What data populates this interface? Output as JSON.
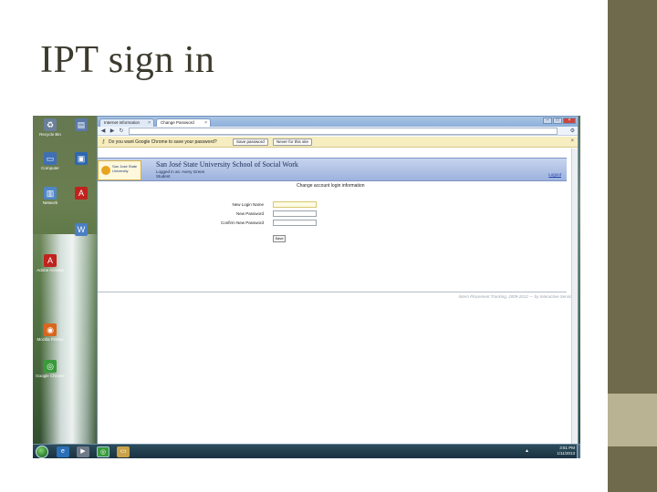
{
  "slide": {
    "title": "IPT sign in",
    "colors": {
      "sidebar": "#6e6a4b",
      "sidebar_accent": "#b9b393",
      "title_text": "#3d3b2e"
    }
  },
  "desktop": {
    "icons": [
      {
        "name": "recycle-bin-icon",
        "label": "Recycle Bin",
        "glyph": "♻"
      },
      {
        "name": "computer-icon",
        "label": "Computer",
        "glyph": "▭"
      },
      {
        "name": "network-icon",
        "label": "Network",
        "glyph": "▥"
      },
      {
        "name": "acrobat-icon",
        "label": "Adobe Acrobat",
        "glyph": "A"
      },
      {
        "name": "firefox-icon",
        "label": "Mozilla Firefox",
        "glyph": "◉"
      },
      {
        "name": "chrome-icon",
        "label": "Google Chrome",
        "glyph": "◎"
      }
    ]
  },
  "browser": {
    "tabs": [
      {
        "label": "Internet Information",
        "active": false
      },
      {
        "label": "Change Password",
        "active": true
      }
    ],
    "url": "",
    "infobar": {
      "message": "Do you want Google Chrome to save your password?",
      "save_label": "Save password",
      "never_label": "Never for this site"
    }
  },
  "page": {
    "school_name": "San José State University School of Social Work",
    "logo_text": "San José State University",
    "user_line_1": "Logged in as: Avery Green",
    "user_line_2": "Student",
    "logout_label": "Logout",
    "form_title": "Change account login information",
    "fields": {
      "new_login_label": "New Login Name",
      "new_password_label": "New Password",
      "confirm_password_label": "Confirm New Password"
    },
    "submit_label": "Save",
    "footer_text": "Intern Placement Tracking, 2009-2012 — by Interactive Services"
  },
  "taskbar": {
    "time": "3:51 PM",
    "date": "1/11/2013"
  }
}
